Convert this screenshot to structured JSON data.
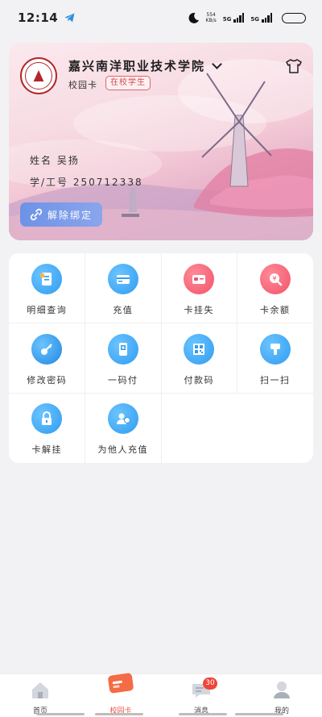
{
  "status_bar": {
    "time": "12:14",
    "signal1": "5G",
    "signal2": "5G",
    "speed_value": "554",
    "speed_unit": "KB/s"
  },
  "card": {
    "school_name": "嘉兴南洋职业技术学院",
    "card_type": "校园卡",
    "badge": "在校学生",
    "name_label": "姓名",
    "name_value": "吴扬",
    "id_label": "学/工号",
    "id_value": "250712338",
    "unbind_label": "解除绑定"
  },
  "services": [
    {
      "label": "明细查询",
      "icon": "document-list-icon",
      "color": "#2f9cf0"
    },
    {
      "label": "充值",
      "icon": "card-recharge-icon",
      "color": "#2f9cf0"
    },
    {
      "label": "卡挂失",
      "icon": "card-report-loss-icon",
      "color": "#f2536b"
    },
    {
      "label": "卡余额",
      "icon": "balance-search-icon",
      "color": "#f2536b"
    },
    {
      "label": "修改密码",
      "icon": "key-icon",
      "color": "#2f9cf0"
    },
    {
      "label": "一码付",
      "icon": "phone-pay-icon",
      "color": "#2f9cf0"
    },
    {
      "label": "付款码",
      "icon": "qr-code-icon",
      "color": "#2f9cf0"
    },
    {
      "label": "扫一扫",
      "icon": "scan-icon",
      "color": "#2f9cf0"
    },
    {
      "label": "卡解挂",
      "icon": "lock-icon",
      "color": "#2f9cf0"
    },
    {
      "label": "为他人充值",
      "icon": "recharge-others-icon",
      "color": "#2f9cf0"
    }
  ],
  "nav": {
    "items": [
      {
        "label": "首页",
        "icon": "home-icon"
      },
      {
        "label": "校园卡",
        "icon": "campus-card-icon"
      },
      {
        "label": "消息",
        "icon": "message-icon"
      },
      {
        "label": "我的",
        "icon": "profile-icon"
      }
    ],
    "active": "校园卡",
    "message_badge": "30"
  }
}
